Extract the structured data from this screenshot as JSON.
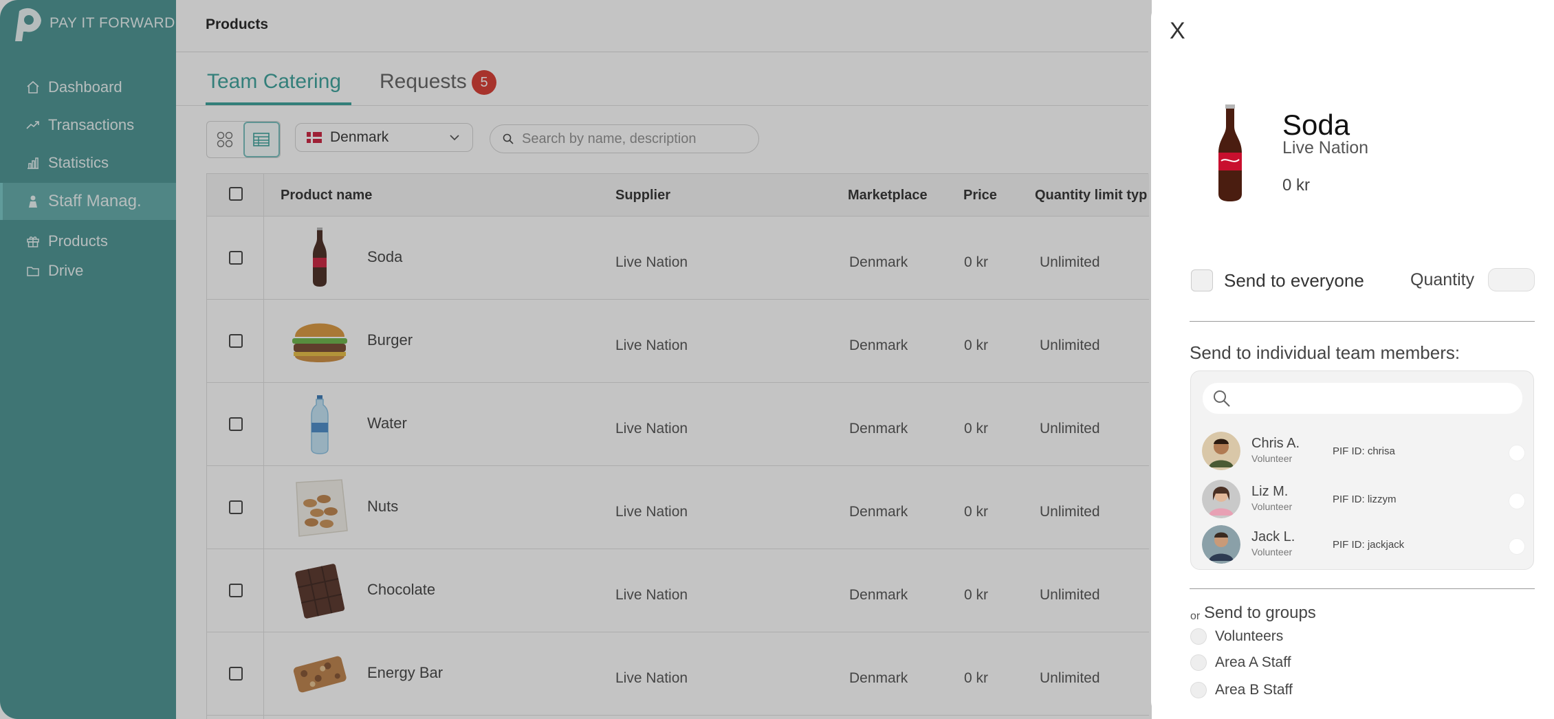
{
  "brand": {
    "name": "PAY IT FORWARD"
  },
  "sidebar": {
    "items": [
      {
        "label": "Dashboard",
        "icon": "home-icon"
      },
      {
        "label": "Transactions",
        "icon": "trend-icon"
      },
      {
        "label": "Statistics",
        "icon": "bar-chart-icon"
      },
      {
        "label": "Staff Manag.",
        "icon": "staff-icon",
        "active": true
      },
      {
        "label": "Products",
        "icon": "gift-icon"
      },
      {
        "label": "Drive",
        "icon": "folder-icon"
      }
    ]
  },
  "header": {
    "title": "Products"
  },
  "tabs": [
    {
      "label": "Team Catering",
      "active": true
    },
    {
      "label": "Requests",
      "badge": "5"
    }
  ],
  "filters": {
    "country": "Denmark",
    "search_placeholder": "Search by name, description"
  },
  "table": {
    "columns": [
      "Product name",
      "Supplier",
      "Marketplace",
      "Price",
      "Quantity limit typ"
    ],
    "rows": [
      {
        "name": "Soda",
        "supplier": "Live Nation",
        "marketplace": "Denmark",
        "price": "0 kr",
        "limit": "Unlimited"
      },
      {
        "name": "Burger",
        "supplier": "Live Nation",
        "marketplace": "Denmark",
        "price": "0 kr",
        "limit": "Unlimited"
      },
      {
        "name": "Water",
        "supplier": "Live Nation",
        "marketplace": "Denmark",
        "price": "0 kr",
        "limit": "Unlimited"
      },
      {
        "name": "Nuts",
        "supplier": "Live Nation",
        "marketplace": "Denmark",
        "price": "0 kr",
        "limit": "Unlimited"
      },
      {
        "name": "Chocolate",
        "supplier": "Live Nation",
        "marketplace": "Denmark",
        "price": "0 kr",
        "limit": "Unlimited"
      },
      {
        "name": "Energy Bar",
        "supplier": "Live Nation",
        "marketplace": "Denmark",
        "price": "0 kr",
        "limit": "Unlimited"
      }
    ]
  },
  "drawer": {
    "close": "X",
    "product": {
      "name": "Soda",
      "supplier": "Live Nation",
      "price": "0 kr"
    },
    "send_everyone": "Send to everyone",
    "quantity_label": "Quantity",
    "individual_label": "Send to individual team members:",
    "members": [
      {
        "name": "Chris A.",
        "role": "Volunteer",
        "pif": "PIF ID: chrisa"
      },
      {
        "name": "Liz M.",
        "role": "Volunteer",
        "pif": "PIF ID: lizzym"
      },
      {
        "name": "Jack L.",
        "role": "Volunteer",
        "pif": "PIF ID: jackjack"
      }
    ],
    "groups_or": "or",
    "groups_label": "Send to groups",
    "groups": [
      "Volunteers",
      "Area A Staff",
      "Area B Staff"
    ]
  },
  "colors": {
    "sidebar": "#3b8b8a",
    "accent": "#2a9a93",
    "badge": "#d42a1f"
  }
}
